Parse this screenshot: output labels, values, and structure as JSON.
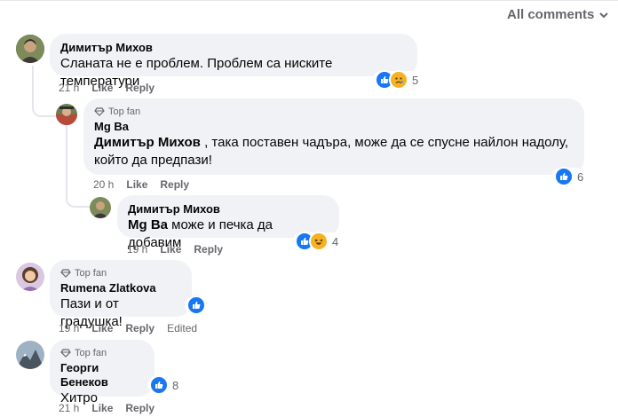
{
  "header": {
    "all_comments_label": "All comments"
  },
  "comments": [
    {
      "author": "Димитър Михов",
      "text": "Сланата не е проблем. Проблем са ниските температури",
      "time": "21 h",
      "like_label": "Like",
      "reply_label": "Reply",
      "reaction_count": "5",
      "reactions": [
        "like-icon",
        "sad-icon"
      ]
    },
    {
      "badge": "Top fan",
      "author": "Mg Ba",
      "mention": "Димитър Михов",
      "text_line1": " , така поставен чадъра, може да се спусне найлон надолу,",
      "text_line2": "който да предпази!",
      "time": "20 h",
      "like_label": "Like",
      "reply_label": "Reply",
      "reaction_count": "6",
      "reactions": [
        "like-icon"
      ]
    },
    {
      "author": "Димитър Михов",
      "mention": "Mg Ba",
      "text": " може и печка да добавим",
      "time": "19 h",
      "like_label": "Like",
      "reply_label": "Reply",
      "reaction_count": "4",
      "reactions": [
        "like-icon",
        "haha-icon"
      ]
    },
    {
      "badge": "Top fan",
      "author": "Rumena Zlatkova",
      "text": "Пази и от градушка!",
      "time": "19 h",
      "like_label": "Like",
      "reply_label": "Reply",
      "edited_label": "Edited",
      "reactions": [
        "like-icon"
      ]
    },
    {
      "badge": "Top fan",
      "author": "Георги Бенеков",
      "text": "Хитро",
      "time": "21 h",
      "like_label": "Like",
      "reply_label": "Reply",
      "reaction_count": "8",
      "reactions": [
        "like-icon"
      ]
    }
  ],
  "colors": {
    "accent": "#1877f2",
    "bubble": "#f0f2f5",
    "secondary_text": "#65676b"
  }
}
